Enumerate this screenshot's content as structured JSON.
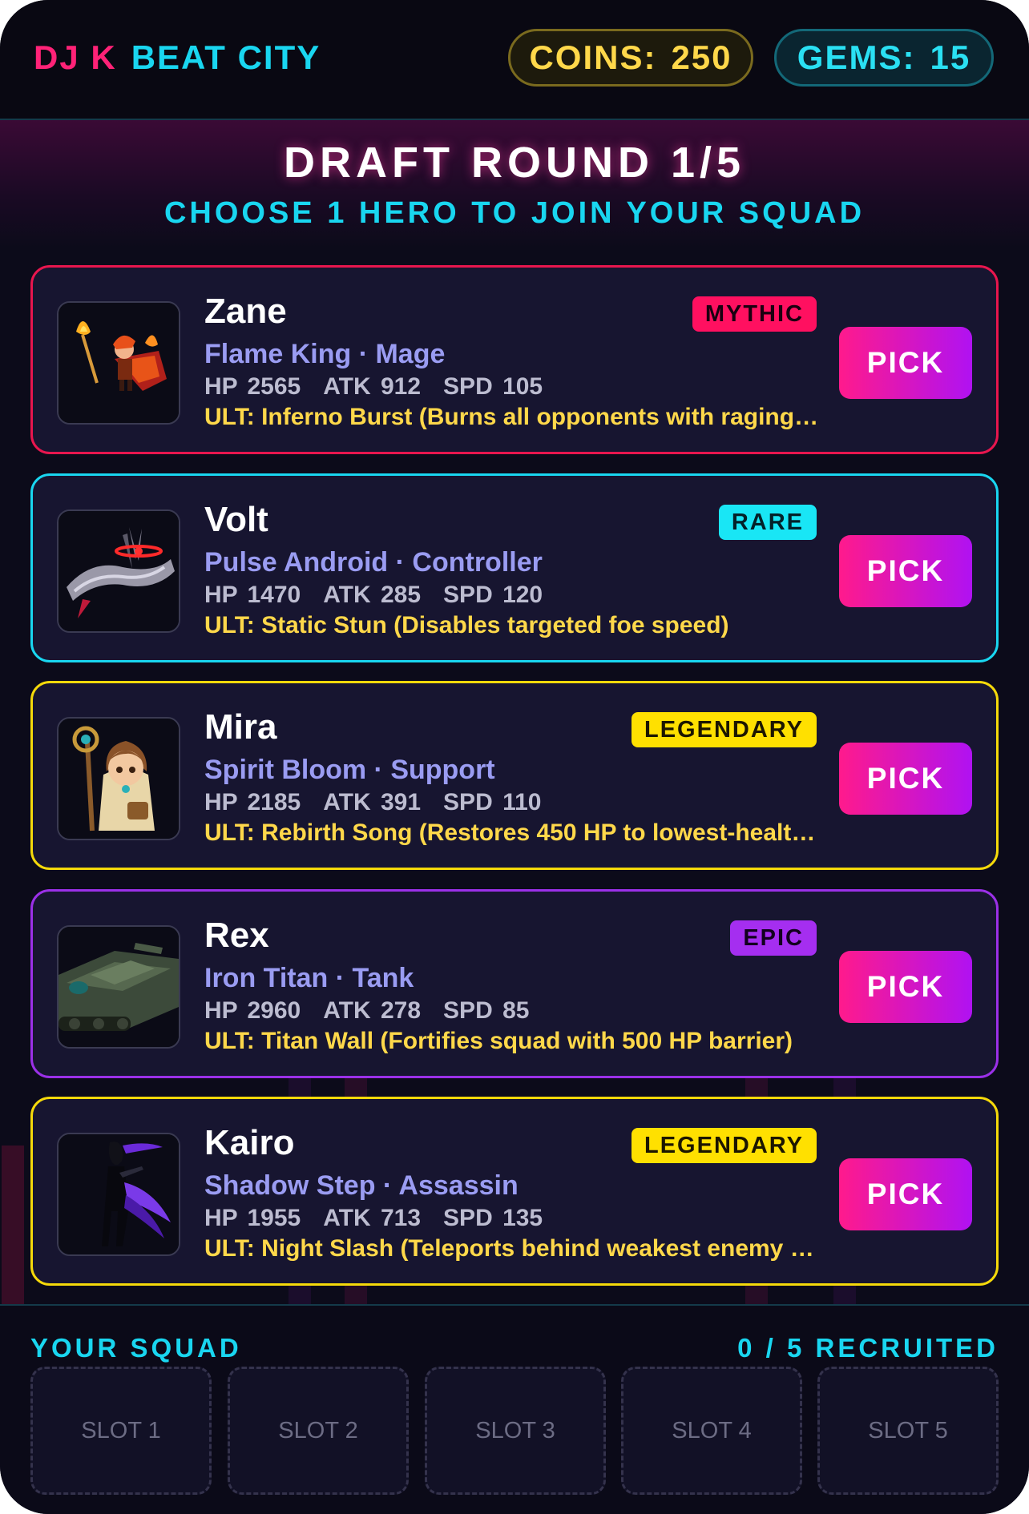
{
  "header": {
    "brand_dj": "DJ K",
    "brand_city": "BEAT CITY",
    "coins_label": "COINS:",
    "coins_value": "250",
    "gems_label": "GEMS:",
    "gems_value": "15"
  },
  "draft": {
    "title": "DRAFT ROUND 1/5",
    "subtitle": "CHOOSE 1 HERO TO JOIN YOUR SQUAD"
  },
  "heroes": [
    {
      "name": "Zane",
      "rarity": "MYTHIC",
      "subtitle": "Flame King · Mage",
      "hp": "HP 2565",
      "atk": "ATK 912",
      "spd": "SPD 105",
      "ult": "ULT: Inferno Burst (Burns all opponents with raging…",
      "pick": "PICK",
      "portrait_icon": "flame-mage-icon",
      "rarity_color": "#ff1060",
      "border_color": "#e8164e"
    },
    {
      "name": "Volt",
      "rarity": "RARE",
      "subtitle": "Pulse Android · Controller",
      "hp": "HP 1470",
      "atk": "ATK 285",
      "spd": "SPD 120",
      "ult": "ULT: Static Stun (Disables targeted foe speed)",
      "pick": "PICK",
      "portrait_icon": "mech-dragon-icon",
      "rarity_color": "#19e6f5",
      "border_color": "#19d6f0"
    },
    {
      "name": "Mira",
      "rarity": "LEGENDARY",
      "subtitle": "Spirit Bloom · Support",
      "hp": "HP 2185",
      "atk": "ATK 391",
      "spd": "SPD 110",
      "ult": "ULT: Rebirth Song (Restores 450 HP to lowest-healt…",
      "pick": "PICK",
      "portrait_icon": "staff-healer-icon",
      "rarity_color": "#ffe000",
      "border_color": "#f5d90a"
    },
    {
      "name": "Rex",
      "rarity": "EPIC",
      "subtitle": "Iron Titan · Tank",
      "hp": "HP 2960",
      "atk": "ATK 278",
      "spd": "SPD 85",
      "ult": "ULT: Titan Wall (Fortifies squad with 500 HP barrier)",
      "pick": "PICK",
      "portrait_icon": "tank-icon",
      "rarity_color": "#a52ef0",
      "border_color": "#9b30e8"
    },
    {
      "name": "Kairo",
      "rarity": "LEGENDARY",
      "subtitle": "Shadow Step · Assassin",
      "hp": "HP 1955",
      "atk": "ATK 713",
      "spd": "SPD 135",
      "ult": "ULT: Night Slash (Teleports behind weakest enemy …",
      "pick": "PICK",
      "portrait_icon": "shadow-assassin-icon",
      "rarity_color": "#ffe000",
      "border_color": "#f5d90a"
    }
  ],
  "squad": {
    "title": "YOUR SQUAD",
    "count": "0 / 5 RECRUITED",
    "slots": [
      "SLOT 1",
      "SLOT 2",
      "SLOT 3",
      "SLOT 4",
      "SLOT 5"
    ]
  },
  "colors": {
    "accent_cyan": "#19d6f0",
    "accent_pink": "#ff2277",
    "coin_gold": "#ffd84a",
    "background": "#0c0b1a"
  }
}
